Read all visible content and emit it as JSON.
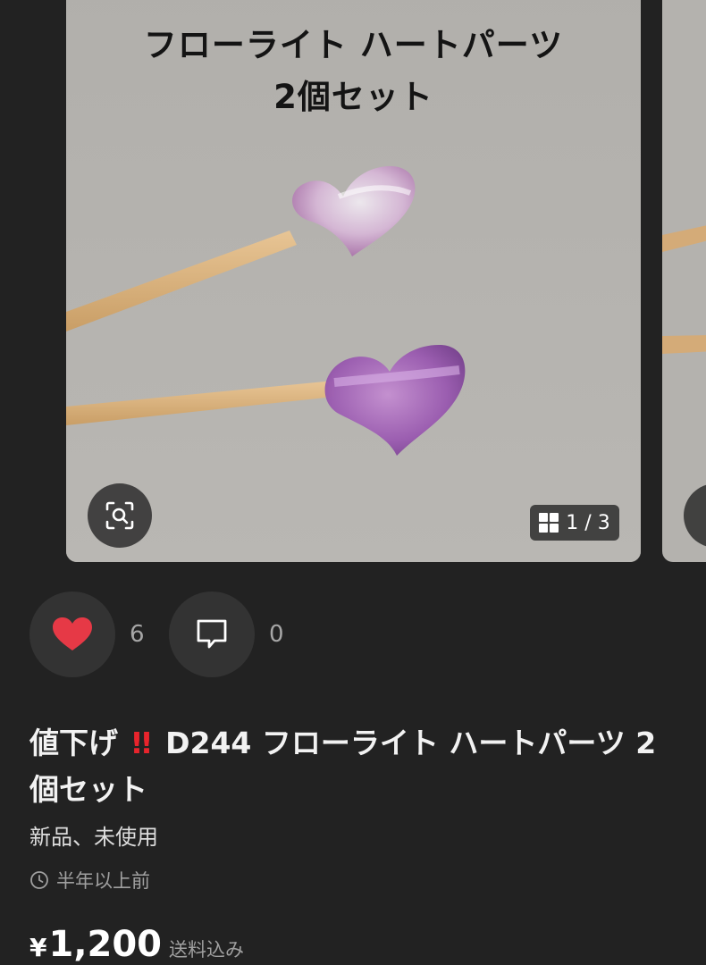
{
  "image": {
    "title_line1": "フローライト ハートパーツ",
    "title_line2": "2個セット",
    "counter": "1 / 3"
  },
  "actions": {
    "like_count": "6",
    "comment_count": "0"
  },
  "item": {
    "title_prefix": "値下げ",
    "title_mark": "!!",
    "title_rest": "D244 フローライト ハートパーツ 2個セット",
    "condition": "新品、未使用",
    "posted": "半年以上前",
    "price_currency": "¥",
    "price_amount": "1,200",
    "shipping": "送料込み"
  },
  "colors": {
    "background": "#222222",
    "like_red": "#e63946",
    "mark_red": "#e8242c"
  },
  "icons": [
    "zoom-scan-icon",
    "gallery-grid-icon",
    "heart-icon",
    "comment-icon",
    "clock-icon"
  ]
}
